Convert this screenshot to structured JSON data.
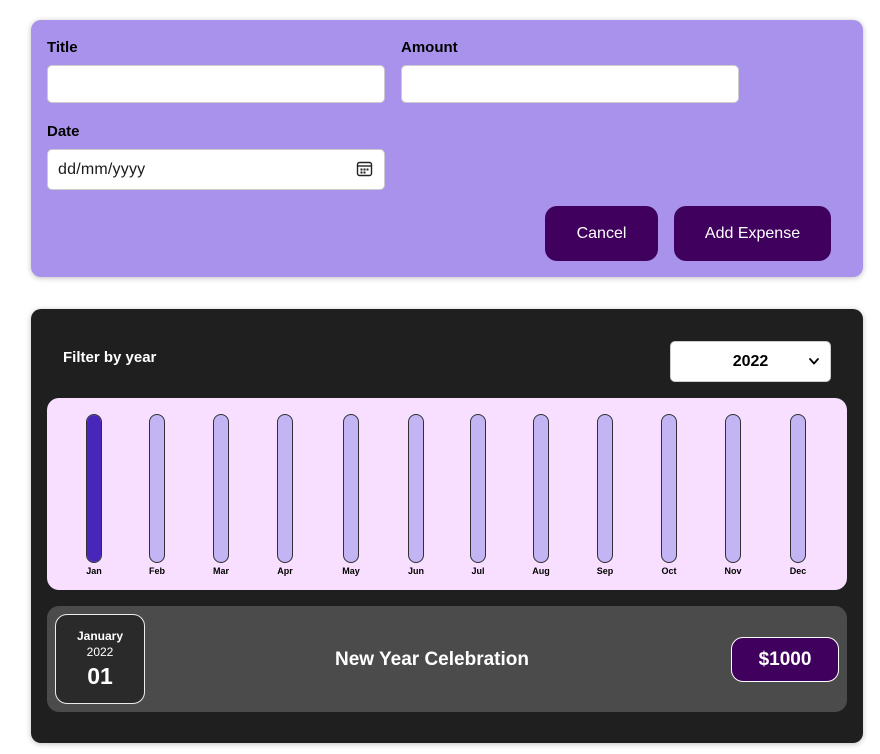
{
  "form": {
    "title_label": "Title",
    "title_value": "",
    "amount_label": "Amount",
    "amount_value": "",
    "date_label": "Date",
    "date_placeholder": "dd/mm/yyyy",
    "cancel_label": "Cancel",
    "submit_label": "Add Expense"
  },
  "filter": {
    "label": "Filter by year",
    "selected_year": "2022"
  },
  "chart_data": {
    "type": "bar",
    "categories": [
      "Jan",
      "Feb",
      "Mar",
      "Apr",
      "May",
      "Jun",
      "Jul",
      "Aug",
      "Sep",
      "Oct",
      "Nov",
      "Dec"
    ],
    "values": [
      1000,
      0,
      0,
      0,
      0,
      0,
      0,
      0,
      0,
      0,
      0,
      0
    ],
    "ylim": [
      0,
      1000
    ]
  },
  "expenses": [
    {
      "month": "January",
      "year": "2022",
      "day": "01",
      "title": "New Year Celebration",
      "amount": "$1000"
    }
  ],
  "colors": {
    "form_bg": "#a892ec",
    "button_bg": "#40005d",
    "panel_bg": "#1f1f1f",
    "chart_bg": "#f8dfff",
    "bar_track": "#c3b4f3",
    "bar_fill": "#4826b9",
    "item_bg": "#4b4b4b"
  },
  "icons": {
    "date": "calendar-icon",
    "select": "chevron-down-icon"
  }
}
